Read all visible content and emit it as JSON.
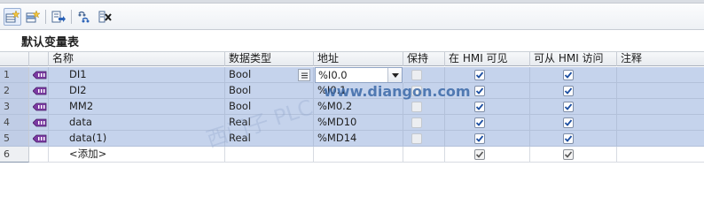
{
  "toolbar": {
    "buttons": [
      {
        "icon": "add-row-icon"
      },
      {
        "icon": "insert-row-icon"
      },
      {
        "icon": "export-icon"
      },
      {
        "icon": "monitor-all-icon"
      },
      {
        "icon": "delete-unused-icon"
      }
    ]
  },
  "table": {
    "title": "默认变量表",
    "columns": {
      "name": "名称",
      "data_type": "数据类型",
      "address": "地址",
      "retain": "保持",
      "visible_in_hmi": "在 HMI 可见",
      "accessible_from_hmi": "可从 HMI 访问",
      "comment": "注释"
    },
    "rows": [
      {
        "num": "1",
        "name": "DI1",
        "data_type": "Bool",
        "address": "%I0.0",
        "retain": false,
        "visible_in_hmi": true,
        "accessible_from_hmi": true,
        "comment": ""
      },
      {
        "num": "2",
        "name": "DI2",
        "data_type": "Bool",
        "address": "%I0.1",
        "retain": false,
        "visible_in_hmi": true,
        "accessible_from_hmi": true,
        "comment": ""
      },
      {
        "num": "3",
        "name": "MM2",
        "data_type": "Bool",
        "address": "%M0.2",
        "retain": false,
        "visible_in_hmi": true,
        "accessible_from_hmi": true,
        "comment": ""
      },
      {
        "num": "4",
        "name": "data",
        "data_type": "Real",
        "address": "%MD10",
        "retain": false,
        "visible_in_hmi": true,
        "accessible_from_hmi": true,
        "comment": ""
      },
      {
        "num": "5",
        "name": "data(1)",
        "data_type": "Real",
        "address": "%MD14",
        "retain": false,
        "visible_in_hmi": true,
        "accessible_from_hmi": true,
        "comment": ""
      }
    ],
    "add_row": {
      "num": "6",
      "placeholder": "<添加>",
      "visible_in_hmi": true,
      "accessible_from_hmi": true
    }
  },
  "watermark": {
    "url": "www.diangon.com",
    "brand_text": "西门子 PLC"
  },
  "colors": {
    "selection": "#c5d3ec",
    "tag_icon": "#6a2e8f",
    "check": "#1d4fa1",
    "watermark": "#3c6aa8"
  }
}
